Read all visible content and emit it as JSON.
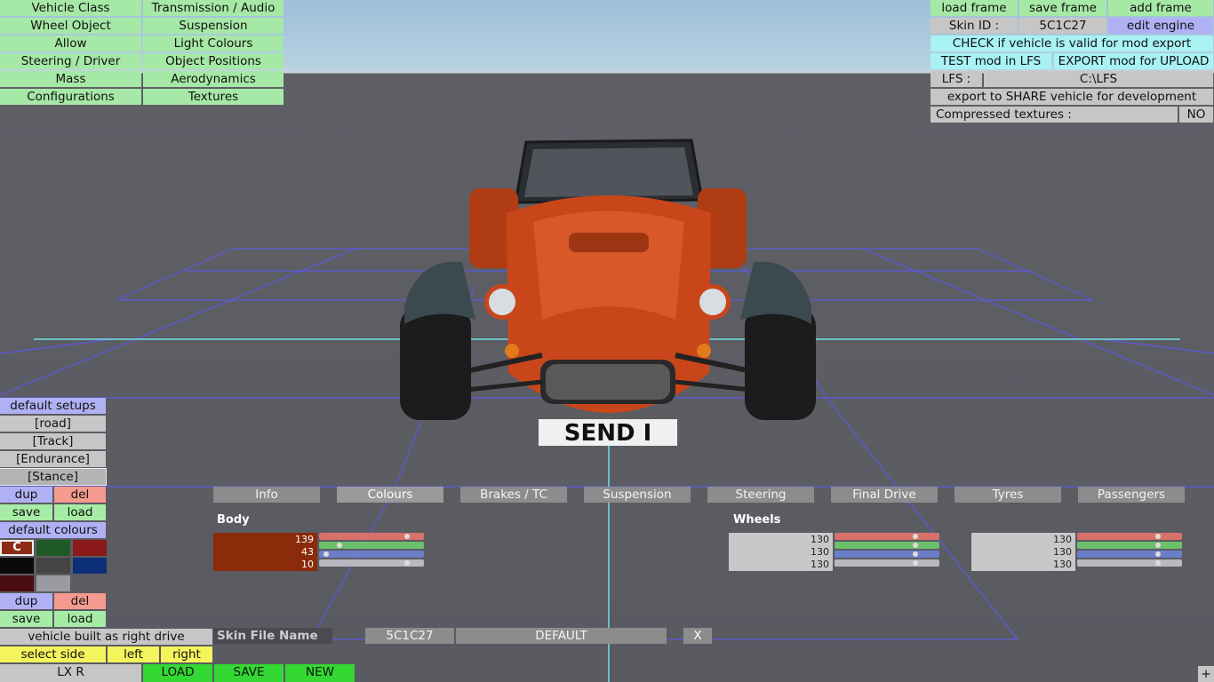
{
  "left_menu": [
    [
      "Vehicle Class",
      "Transmission / Audio"
    ],
    [
      "Wheel Object",
      "Suspension"
    ],
    [
      "Allow",
      "Light Colours"
    ],
    [
      "Steering / Driver",
      "Object Positions"
    ],
    [
      "Mass",
      "Aerodynamics"
    ],
    [
      "Configurations",
      "Textures"
    ]
  ],
  "top_right": {
    "load_frame": "load frame",
    "save_frame": "save frame",
    "add_frame": "add frame",
    "skin_id_label": "Skin ID :",
    "skin_id_value": "5C1C27",
    "edit_engine": "edit engine",
    "check_valid": "CHECK if vehicle is valid for mod export",
    "test_mod": "TEST mod in LFS",
    "export_upload": "EXPORT mod for UPLOAD",
    "lfs_label": "LFS :",
    "lfs_path": "C:\\LFS",
    "export_share": "export to SHARE vehicle for development",
    "compressed_label": "Compressed textures :",
    "compressed_value": "NO"
  },
  "car": {
    "plate": "SEND I"
  },
  "setups": {
    "header": "default setups",
    "items": [
      "[road]",
      "[Track]",
      "[Endurance]",
      "[Stance]"
    ],
    "dup": "dup",
    "del": "del",
    "save": "save",
    "load": "load"
  },
  "colours": {
    "header": "default colours",
    "swatch_c_label": "C",
    "swatches": [
      "#8b2b16",
      "#1f5a26",
      "#8c1a1a",
      "#0a0a0a",
      "#454545",
      "#0d2e78",
      "#4a0d10",
      "#9a9aa0"
    ],
    "dup": "dup",
    "del": "del",
    "save": "save",
    "load": "load"
  },
  "drive": {
    "built_as": "vehicle built as right drive",
    "select_side": "select side",
    "left": "left",
    "right": "right"
  },
  "bottom": {
    "car_name": "LX R",
    "load": "LOAD",
    "save": "SAVE",
    "new": "NEW",
    "plus": "+"
  },
  "tabs": [
    "Info",
    "Colours",
    "Brakes / TC",
    "Suspension",
    "Steering",
    "Final Drive",
    "Tyres",
    "Passengers"
  ],
  "active_tab": "Colours",
  "body": {
    "label": "Body",
    "swatch_color": "#8b2b0a",
    "values": [
      "139",
      "43",
      "10"
    ],
    "slider_levels": [
      0.86,
      0.17,
      0.04,
      0.86
    ]
  },
  "wheels": {
    "label": "Wheels",
    "left": {
      "values": [
        "130",
        "130",
        "130"
      ],
      "slider_levels": [
        0.79,
        0.79,
        0.79,
        0.79
      ]
    },
    "right": {
      "values": [
        "130",
        "130",
        "130"
      ],
      "slider_levels": [
        0.79,
        0.79,
        0.79,
        0.79
      ]
    }
  },
  "skin_file": {
    "label": "Skin File Name",
    "name": "5C1C27",
    "default": "DEFAULT",
    "clear": "X"
  },
  "slider_colors": [
    "#d9726a",
    "#6cc06c",
    "#6b7ec9",
    "#b8b8c0"
  ]
}
